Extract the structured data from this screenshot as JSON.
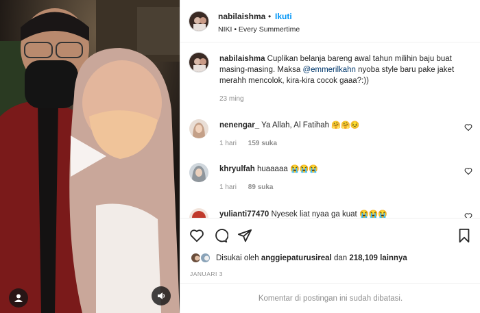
{
  "post": {
    "username": "nabilaishma",
    "dot": "•",
    "follow_label": "Ikuti",
    "song": "NIKI • Every Summertime",
    "more_icon": "more-horizontal-icon"
  },
  "caption": {
    "username": "nabilaishma",
    "text_before": "Cuplikan belanja bareng awal tahun milihin baju buat masing-masing. Maksa ",
    "mention": "@emmerilkahn",
    "text_after": " nyoba style baru pake jaket merahh mencolok, kira-kira cocok gaaa?:))",
    "time": "23 ming"
  },
  "comments": [
    {
      "username": "nenengar_",
      "text": "Ya Allah, Al Fatihah",
      "emoji": "🤗🤗😣",
      "time": "1 hari",
      "likes": "159 suka"
    },
    {
      "username": "khryulfah",
      "text": "huaaaaa",
      "emoji": "😭😭😭",
      "time": "1 hari",
      "likes": "89 suka"
    },
    {
      "username": "yulianti77470",
      "text": "Nyesek liat nyaa ga kuat",
      "emoji": "😭😭😭",
      "time": "",
      "likes": ""
    }
  ],
  "likes": {
    "prefix": "Disukai oleh",
    "user": "anggiepaturusireal",
    "middle": "dan",
    "count": "218,109",
    "suffix": "lainnya"
  },
  "date": "JANUARI 3",
  "comments_disabled": "Komentar di postingan ini sudah dibatasi.",
  "colors": {
    "link_blue": "#0095f6",
    "mention_blue": "#00376b",
    "muted": "#8e8e8e",
    "text": "#262626"
  }
}
